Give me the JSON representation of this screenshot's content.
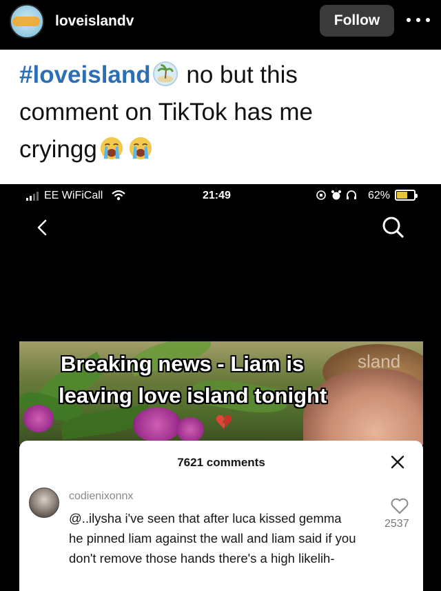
{
  "header": {
    "username": "loveislandv",
    "follow_label": "Follow",
    "more_icon": "more-options-icon"
  },
  "caption": {
    "hashtag": "#loveisland",
    "line1_rest": " no but this",
    "line2": "comment on TikTok has me",
    "line3": "cryingg",
    "emojis": [
      "island-icon",
      "loudly-crying-face-icon",
      "loudly-crying-face-icon"
    ]
  },
  "screenshot": {
    "status_bar": {
      "carrier": "EE WiFiCall",
      "time": "21:49",
      "battery": "62%"
    },
    "video": {
      "headline_line1": "Breaking news - Liam is",
      "headline_line2": "leaving love island tonight",
      "watermark": "sland"
    },
    "comments": {
      "count_label": "7621 comments",
      "items": [
        {
          "username": "codienixonnx",
          "text": "@..ilysha i've seen that after luca kissed gemma he pinned liam against the wall and liam said if you don't remove those hands there's a high likelih-",
          "likes": "2537"
        }
      ]
    }
  },
  "colors": {
    "hashtag": "#2c6fb4",
    "follow_button_bg": "#3a3a3a",
    "battery_fill": "#e6c33a"
  }
}
